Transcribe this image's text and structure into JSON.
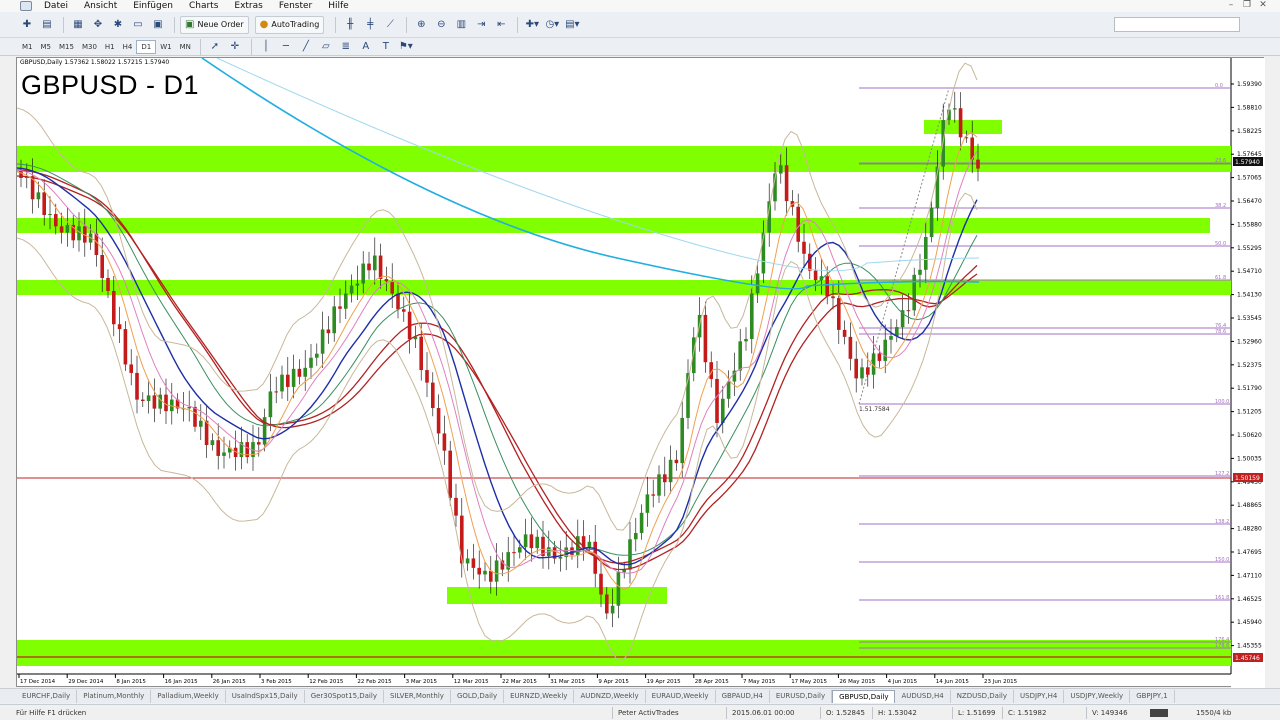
{
  "menu": [
    "Datei",
    "Ansicht",
    "Einfügen",
    "Charts",
    "Extras",
    "Fenster",
    "Hilfe"
  ],
  "toolbar": {
    "new_order": "Neue Order",
    "auto_trading": "AutoTrading",
    "timeframes": [
      "M1",
      "M5",
      "M15",
      "M30",
      "H1",
      "H4",
      "D1",
      "W1",
      "MN"
    ],
    "active_timeframe": "D1"
  },
  "chart": {
    "symbol_info": "GBPUSD,Daily  1.57362 1.58022 1.57215 1.57940",
    "title": "GBPUSD - D1",
    "current_price": "1.57940",
    "marked_price": "1.50159",
    "bottom_price": "1.45746",
    "price_labels": [
      "1.59390",
      "1.58810",
      "1.58225",
      "1.57645",
      "1.57065",
      "1.56470",
      "1.55880",
      "1.55295",
      "1.54710",
      "1.54130",
      "1.53545",
      "1.52960",
      "1.52375",
      "1.51790",
      "1.51205",
      "1.50620",
      "1.50035",
      "1.49450",
      "1.48865",
      "1.48280",
      "1.47695",
      "1.47110",
      "1.46525",
      "1.45940",
      "1.45355"
    ],
    "date_labels": [
      "17 Dec 2014",
      "29 Dec 2014",
      "8 Jan 2015",
      "16 Jan 2015",
      "26 Jan 2015",
      "3 Feb 2015",
      "12 Feb 2015",
      "22 Feb 2015",
      "3 Mar 2015",
      "12 Mar 2015",
      "22 Mar 2015",
      "31 Mar 2015",
      "9 Apr 2015",
      "19 Apr 2015",
      "28 Apr 2015",
      "7 May 2015",
      "17 May 2015",
      "26 May 2015",
      "4 Jun 2015",
      "14 Jun 2015",
      "23 Jun 2015"
    ],
    "fib_levels": [
      "0.0",
      "23.6",
      "38.2",
      "50.0",
      "61.8",
      "76.4",
      "78.6",
      "100.0",
      "127.2",
      "138.2",
      "150.0",
      "161.8",
      "176.4",
      "178.6"
    ],
    "low_label": "1.51.7584",
    "colors": {
      "zone": "#7fff00",
      "bull_candle": "#2e8b22",
      "bear_candle": "#c41a1a",
      "ma_red": "#b22222",
      "ma_blue": "#1c2fa8",
      "ma_cyan": "#22aee0",
      "ma_orange": "#f0a050",
      "ma_pink": "#e080c0",
      "ma_green": "#3a8f5f",
      "bollinger": "#c8b89a",
      "fib": "#a070c0",
      "marker_line": "#c02020"
    }
  },
  "tabs": [
    "EURCHF,Daily",
    "Platinum,Monthly",
    "Palladium,Weekly",
    "UsaIndSpx15,Daily",
    "Ger30Spot15,Daily",
    "SILVER,Monthly",
    "GOLD,Daily",
    "EURNZD,Weekly",
    "AUDNZD,Weekly",
    "EURAUD,Weekly",
    "GBPAUD,H4",
    "EURUSD,Daily",
    "GBPUSD,Daily",
    "AUDUSD,H4",
    "NZDUSD,Daily",
    "USDJPY,H4",
    "USDJPY,Weekly",
    "GBPJPY,1"
  ],
  "active_tab": "GBPUSD,Daily",
  "status": {
    "help": "Für Hilfe F1 drücken",
    "profile": "Peter ActivTrades",
    "datetime": "2015.06.01 00:00",
    "open": "O: 1.52845",
    "high": "H: 1.53042",
    "low": "L: 1.51699",
    "close": "C: 1.51982",
    "volume": "V: 149346",
    "traffic": "1550/4 kb"
  }
}
